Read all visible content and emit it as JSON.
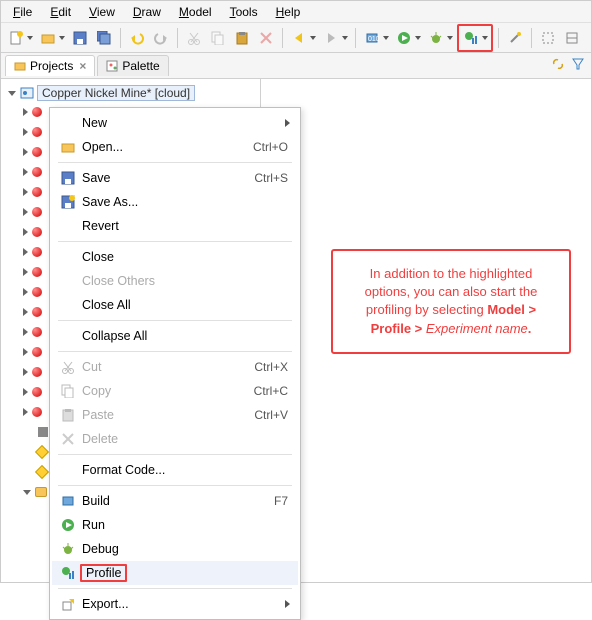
{
  "menubar": {
    "items": [
      "File",
      "Edit",
      "View",
      "Draw",
      "Model",
      "Tools",
      "Help"
    ]
  },
  "toolbar": {
    "icons": [
      {
        "name": "new-icon"
      },
      {
        "name": "open-icon"
      },
      {
        "name": "save-icon"
      },
      {
        "name": "save-all-icon"
      },
      {
        "name": "undo-icon"
      },
      {
        "name": "redo-icon"
      },
      {
        "name": "cut-icon"
      },
      {
        "name": "copy-icon"
      },
      {
        "name": "paste-icon"
      },
      {
        "name": "delete-icon"
      },
      {
        "name": "nav-back-icon"
      },
      {
        "name": "nav-fwd-icon"
      },
      {
        "name": "build-icon"
      },
      {
        "name": "run-icon"
      },
      {
        "name": "debug-icon"
      },
      {
        "name": "profile-icon"
      },
      {
        "name": "wand-icon"
      },
      {
        "name": "select-icon"
      },
      {
        "name": "fit-icon"
      }
    ]
  },
  "tabs": {
    "projects": {
      "label": "Projects"
    },
    "palette": {
      "label": "Palette"
    }
  },
  "tree": {
    "root_label": "Copper Nickel Mine*  [cloud]"
  },
  "context_menu": {
    "new": "New",
    "open": "Open...",
    "open_sc": "Ctrl+O",
    "save": "Save",
    "save_sc": "Ctrl+S",
    "save_as": "Save As...",
    "revert": "Revert",
    "close": "Close",
    "close_others": "Close Others",
    "close_all": "Close All",
    "collapse_all": "Collapse All",
    "cut": "Cut",
    "cut_sc": "Ctrl+X",
    "copy": "Copy",
    "copy_sc": "Ctrl+C",
    "paste": "Paste",
    "paste_sc": "Ctrl+V",
    "delete": "Delete",
    "format_code": "Format Code...",
    "build": "Build",
    "build_sc": "F7",
    "run": "Run",
    "debug": "Debug",
    "profile": "Profile",
    "export": "Export..."
  },
  "callout": {
    "t1": "In addition to the highlighted options, you can also start the profiling by selecting ",
    "t2": "Model > Profile > ",
    "t3": "Experiment name",
    "t4": "."
  }
}
